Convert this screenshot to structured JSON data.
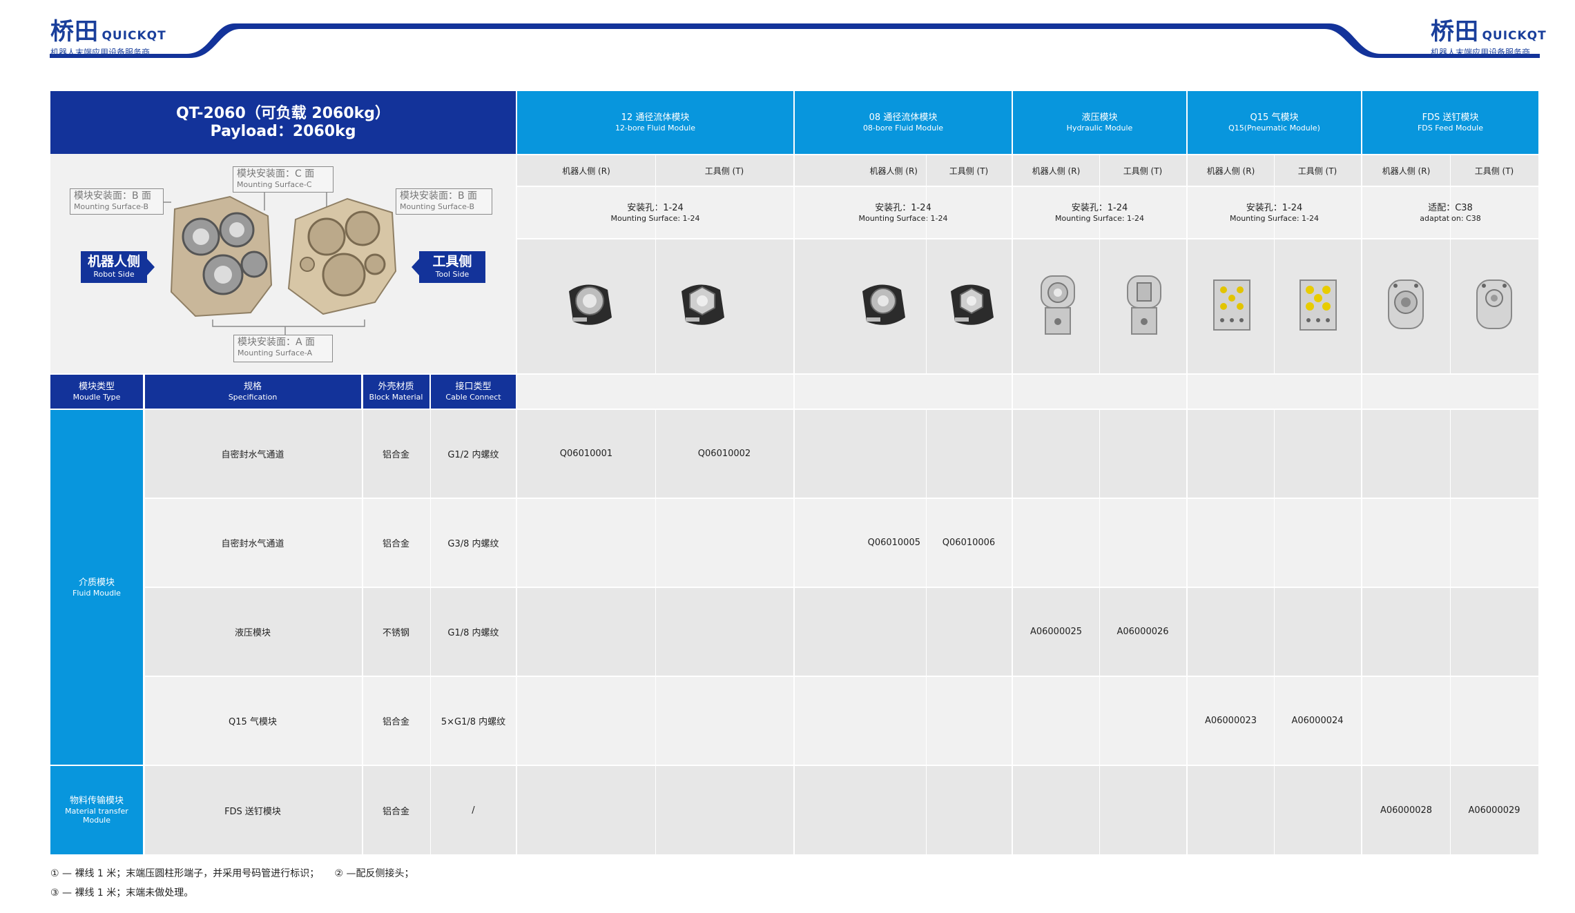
{
  "header": {
    "logo_zh": "桥田",
    "logo_en": "QUICKQT",
    "logo_sub": "机器人末端应用设备服务商"
  },
  "table": {
    "title_line1": "QT-2060（可负载 2060kg）",
    "title_line2": "Payload：2060kg",
    "modules": [
      {
        "zh": "12 通径流体模块",
        "en": "12-bore Fluid Module",
        "mount_zh": "安装孔：1-24",
        "mount_en": "Mounting Surface: 1-24"
      },
      {
        "zh": "08 通径流体模块",
        "en": "08-bore Fluid Module",
        "mount_zh": "安装孔：1-24",
        "mount_en": "Mounting Surface: 1-24"
      },
      {
        "zh": "液压模块",
        "en": "Hydraulic Module",
        "mount_zh": "安装孔：1-24",
        "mount_en": "Mounting Surface: 1-24"
      },
      {
        "zh": "Q15 气模块",
        "en": "Q15(Pneumatic  Module)",
        "mount_zh": "安装孔：1-24",
        "mount_en": "Mounting Surface: 1-24"
      },
      {
        "zh": "FDS 送钉模块",
        "en": "FDS Feed Module",
        "mount_zh": "适配：C38",
        "mount_en": "adaptation: C38"
      }
    ],
    "side_robot": "机器人侧 (R)",
    "side_tool": "工具侧 (T)",
    "diagram": {
      "surface_c_zh": "模块安装面：C 面",
      "surface_c_en": "Mounting Surface-C",
      "surface_b_zh": "模块安装面：B 面",
      "surface_b_en": "Mounting Surface-B",
      "surface_a_zh": "模块安装面：A 面",
      "surface_a_en": "Mounting Surface-A",
      "robot_zh": "机器人侧",
      "robot_en": "Robot Side",
      "tool_zh": "工具侧",
      "tool_en": "Tool Side"
    },
    "col_headers": [
      {
        "zh": "模块类型",
        "en": "Moudle Type"
      },
      {
        "zh": "规格",
        "en": "Specification"
      },
      {
        "zh": "外壳材质",
        "en": "Block Material"
      },
      {
        "zh": "接口类型",
        "en": "Cable Connect"
      }
    ],
    "groups": [
      {
        "zh": "介质模块",
        "en": "Fluid Moudle"
      },
      {
        "zh": "物料传输模块",
        "en1": "Material transfer",
        "en2": "Module"
      }
    ],
    "rows": [
      {
        "spec": "自密封水气通道",
        "material": "铝合金",
        "connect": "G1/2 内螺纹",
        "codes": [
          "Q06010001",
          "Q06010002"
        ]
      },
      {
        "spec": "自密封水气通道",
        "material": "铝合金",
        "connect": "G3/8 内螺纹",
        "codes": [
          "Q06010005",
          "Q06010006"
        ]
      },
      {
        "spec": "液压模块",
        "material": "不锈钢",
        "connect": "G1/8 内螺纹",
        "codes": [
          "A06000025",
          "A06000026"
        ]
      },
      {
        "spec": "Q15 气模块",
        "material": "铝合金",
        "connect": "5×G1/8 内螺纹",
        "codes": [
          "A06000023",
          "A06000024"
        ]
      },
      {
        "spec": "FDS 送钉模块",
        "material": "铝合金",
        "connect": "/",
        "codes": [
          "A06000028",
          "A06000029"
        ]
      }
    ]
  },
  "notes": {
    "line1": "① — 裸线 1 米；末端压圆柱形端子，并采用号码管进行标识；     ② —配反侧接头；",
    "line2": "③ — 裸线 1 米；末端未做处理。"
  },
  "colors": {
    "navy": "#13339a",
    "blue": "#0896dd",
    "gray_dark": "#e7e7e7",
    "gray_light": "#f1f1f1"
  }
}
